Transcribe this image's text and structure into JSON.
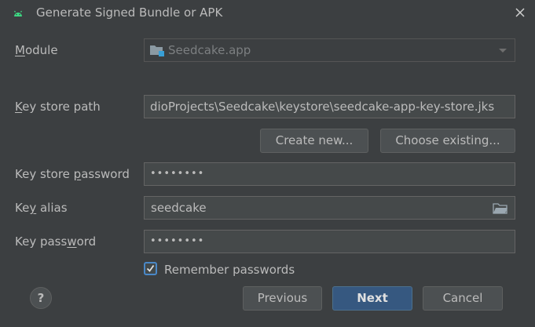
{
  "window": {
    "title": "Generate Signed Bundle or APK"
  },
  "module": {
    "label_mnemonic": "M",
    "label_rest": "odule",
    "value": "Seedcake.app"
  },
  "key_store_path": {
    "label_mnemonic": "K",
    "label_rest": "ey store path",
    "value": "dioProjects\\Seedcake\\keystore\\seedcake-app-key-store.jks"
  },
  "buttons": {
    "create_new": "Create new...",
    "choose_existing": "Choose existing..."
  },
  "key_store_password": {
    "label_before": "Key store ",
    "label_mnemonic": "p",
    "label_after": "assword",
    "value": "••••••••"
  },
  "key_alias": {
    "label_before": "Ke",
    "label_mnemonic": "y",
    "label_after": " alias",
    "value": "seedcake"
  },
  "key_password": {
    "label_before": "Key pass",
    "label_mnemonic": "w",
    "label_after": "ord",
    "value": "••••••••"
  },
  "remember": {
    "checked": true,
    "label": "Remember passwords"
  },
  "footer": {
    "help": "?",
    "previous": "Previous",
    "next": "Next",
    "cancel": "Cancel"
  },
  "colors": {
    "background": "#3c3f41",
    "field_bg": "#45494a",
    "accent": "#365880",
    "checkbox_border": "#4a88c7",
    "android_green": "#3ddc84"
  },
  "icons": {
    "app": "android-icon",
    "close": "close-icon",
    "module": "module-folder-icon",
    "dropdown": "chevron-down-icon",
    "browse": "folder-icon",
    "check": "checkmark-icon"
  }
}
